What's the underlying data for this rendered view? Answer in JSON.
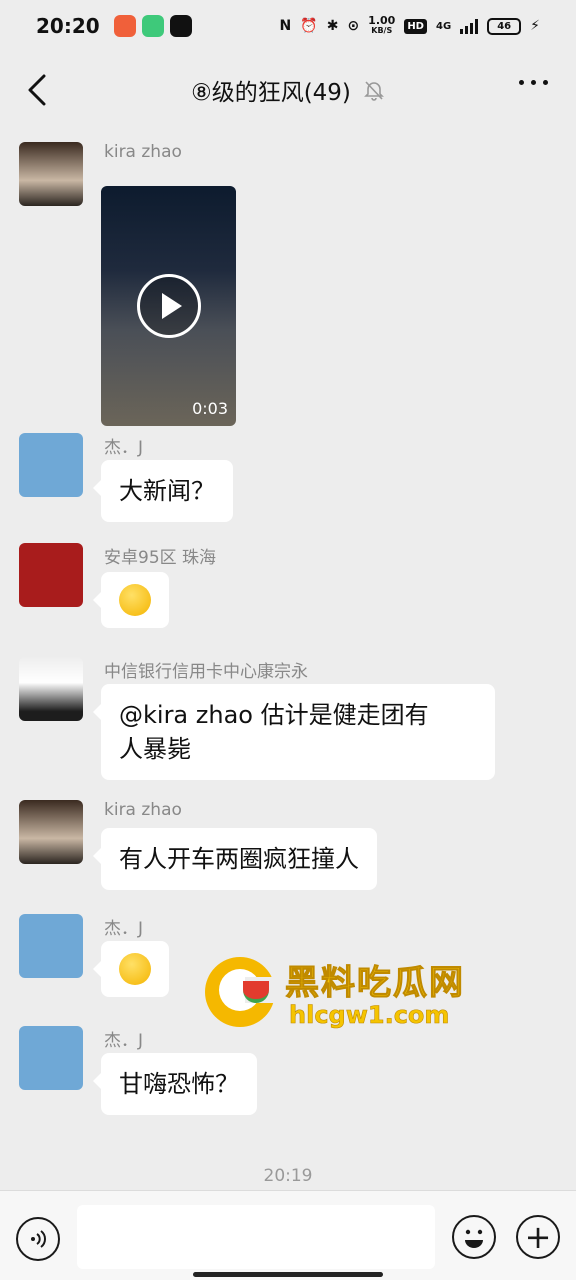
{
  "status_bar": {
    "time": "20:20",
    "net_speed": "1.00",
    "net_unit": "KB/S",
    "hd": "HD",
    "network": "4G",
    "battery": "46",
    "icons": [
      "nfc-icon",
      "alarm-icon",
      "bluetooth-icon",
      "location-icon",
      "charging-icon"
    ]
  },
  "nav": {
    "title": "⑧级的狂风(49)",
    "muted_icon": "bell-off-icon"
  },
  "messages": [
    {
      "sender": "kira zhao",
      "type": "video",
      "duration": "0:03"
    },
    {
      "sender": "杰．J",
      "type": "text",
      "text": "大新闻？"
    },
    {
      "sender": "安卓95区  珠海",
      "type": "emoji",
      "emoji": "shocked-emoji"
    },
    {
      "sender": "中信银行信用卡中心康宗永",
      "type": "text",
      "text_line1": "@kira zhao",
      "text_line1b": " 估计是健走团有",
      "text_line2": "人暴毙"
    },
    {
      "sender": "kira zhao",
      "type": "text",
      "text": "有人开车两圈疯狂撞人"
    },
    {
      "sender": "杰．J",
      "type": "emoji",
      "emoji": "laugh-cry-emoji"
    },
    {
      "sender": "杰．J",
      "type": "text",
      "text": "甘嗨恐怖？"
    }
  ],
  "timestamp": "20:19",
  "watermark": {
    "title": "黑料吃瓜网",
    "url": "hlcgw1.com"
  },
  "input_bar": {
    "placeholder": ""
  },
  "colors": {
    "background": "#ededed",
    "bubble": "#ffffff",
    "sender": "#888888",
    "watermark": "#f5c400"
  }
}
